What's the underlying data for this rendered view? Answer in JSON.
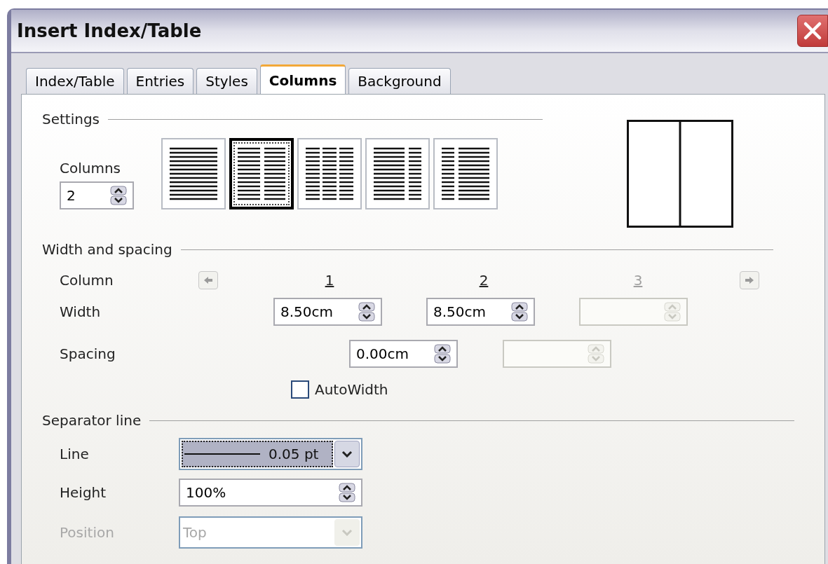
{
  "window": {
    "title": "Insert Index/Table"
  },
  "tabs": [
    {
      "label": "Index/Table",
      "selected": false
    },
    {
      "label": "Entries",
      "selected": false
    },
    {
      "label": "Styles",
      "selected": false
    },
    {
      "label": "Columns",
      "selected": true
    },
    {
      "label": "Background",
      "selected": false
    }
  ],
  "settings": {
    "heading": "Settings",
    "columns_label": "Columns",
    "columns_value": "2",
    "presets": [
      {
        "kind": "one",
        "selected": false
      },
      {
        "kind": "two",
        "selected": true
      },
      {
        "kind": "three",
        "selected": false
      },
      {
        "kind": "left-wide",
        "selected": false
      },
      {
        "kind": "right-wide",
        "selected": false
      }
    ]
  },
  "width_and_spacing": {
    "heading": "Width and spacing",
    "column_label": "Column",
    "prev_disabled": true,
    "next_disabled": true,
    "column_numbers": [
      {
        "text": "1",
        "disabled": false
      },
      {
        "text": "2",
        "disabled": false
      },
      {
        "text": "3",
        "disabled": true
      }
    ],
    "width_label": "Width",
    "widths": [
      {
        "value": "8.50cm",
        "disabled": false
      },
      {
        "value": "8.50cm",
        "disabled": false
      },
      {
        "disabled": true
      }
    ],
    "spacing_label": "Spacing",
    "spacings": [
      {
        "value": "0.00cm",
        "disabled": false
      },
      {
        "disabled": true
      }
    ],
    "autowidth": {
      "label": "AutoWidth",
      "checked": false
    }
  },
  "separator_line": {
    "heading": "Separator line",
    "line": {
      "label": "Line",
      "value": "0.05 pt",
      "focused": true
    },
    "height": {
      "label": "Height",
      "value": "100%"
    },
    "position": {
      "label": "Position",
      "value": "Top",
      "disabled": true
    }
  }
}
